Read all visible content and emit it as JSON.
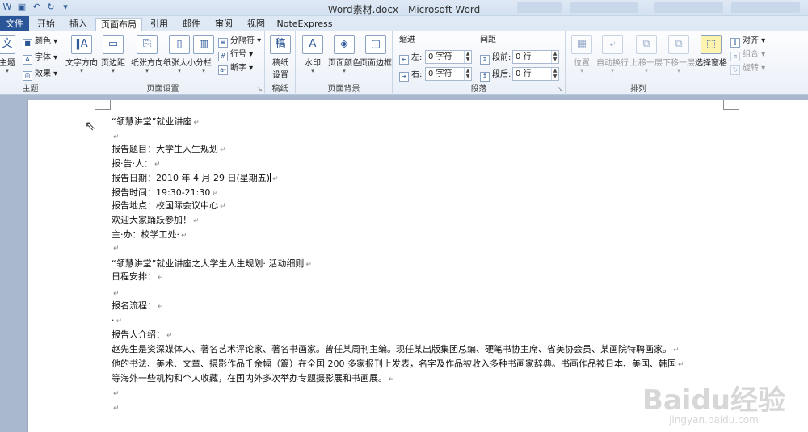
{
  "titlebar": {
    "title": "Word素材.docx - Microsoft Word"
  },
  "tabs": [
    {
      "label": "文件"
    },
    {
      "label": "开始"
    },
    {
      "label": "插入"
    },
    {
      "label": "页面布局"
    },
    {
      "label": "引用"
    },
    {
      "label": "邮件"
    },
    {
      "label": "审阅"
    },
    {
      "label": "视图"
    },
    {
      "label": "NoteExpress"
    }
  ],
  "ribbon": {
    "theme": {
      "label": "主题",
      "btn": "主题",
      "colors": "颜色",
      "fonts": "字体",
      "effects": "效果"
    },
    "page_setup": {
      "label": "页面设置",
      "text_direction": "文字方向",
      "margins": "页边距",
      "orientation": "纸张方向",
      "size": "纸张大小",
      "columns": "分栏",
      "breaks": "分隔符",
      "line_numbers": "行号",
      "hyphenation": "断字"
    },
    "draft": {
      "label": "稿纸",
      "btn1": "稿纸",
      "btn2": "设置"
    },
    "page_background": {
      "label": "页面背景",
      "watermark": "水印",
      "page_color": "页面颜色",
      "page_borders": "页面边框"
    },
    "paragraph": {
      "label": "段落",
      "indent_title": "缩进",
      "spacing_title": "间距",
      "left": "左:",
      "right": "右:",
      "before": "段前:",
      "after": "段后:",
      "left_val": "0 字符",
      "right_val": "0 字符",
      "before_val": "0 行",
      "after_val": "0 行"
    },
    "arrange": {
      "label": "排列",
      "position": "位置",
      "wrap": "自动换行",
      "bring_forward": "上移一层",
      "send_backward": "下移一层",
      "selection_pane": "选择窗格",
      "align": "对齐",
      "group": "组合",
      "rotate": "旋转"
    }
  },
  "document": {
    "lines": [
      "“领慧讲堂”就业讲座",
      "",
      "报告题目：大学生人生规划",
      "报·告·人：",
      "报告日期：2010 年 4 月 29 日(星期五)",
      "报告时间：19:30-21:30",
      "报告地点：校国际会议中心",
      "欢迎大家踊跃参加！",
      "主·办：校学工处·",
      "",
      "“领慧讲堂”就业讲座之大学生人生规划· 活动细则",
      "日程安排：",
      "",
      "报名流程：",
      "·",
      "报告人介绍：",
      "赵先生是资深媒体人、著名艺术评论家、著名书画家。曾任某周刊主编。现任某出版集团总编、硬笔书协主席、省美协会员、某画院特聘画家。",
      "他的书法、美术、文章、摄影作品千余幅（篇）在全国 200 多家报刊上发表，名字及作品被收入多种书画家辞典。书画作品被日本、美国、韩国",
      "等海外一些机构和个人收藏，在国内外多次举办专题摄影展和书画展。",
      "",
      ""
    ],
    "paragraph_mark": "↵"
  },
  "watermark": {
    "brand": "Baidu经验",
    "url": "jingyan.baidu.com"
  }
}
